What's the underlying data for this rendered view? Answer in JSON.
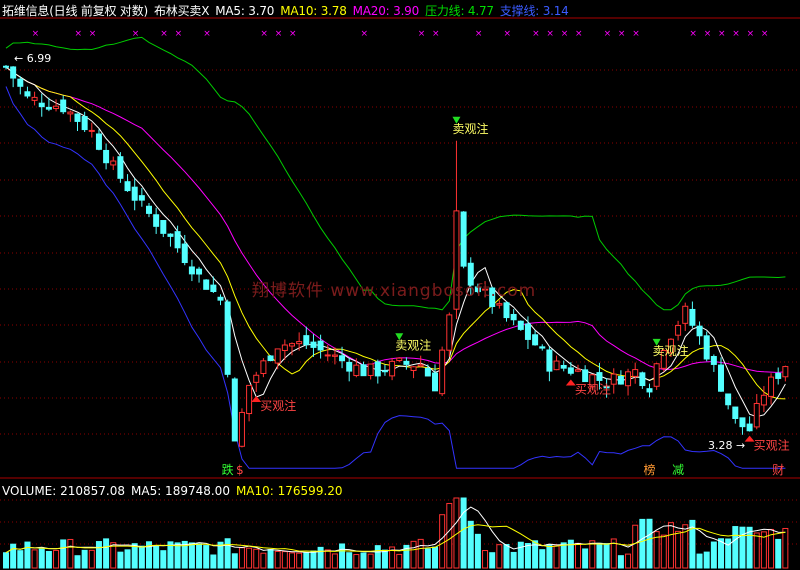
{
  "header": {
    "stock": "拓维信息(日线 前复权 对数)",
    "indicator": "布林买卖X",
    "ma5": "MA5: 3.70",
    "ma10": "MA10: 3.78",
    "ma20": "MA20: 3.90",
    "pressure": "压力线: 4.77",
    "support": "支撑线: 3.14"
  },
  "volume_header": {
    "volume": "VOLUME: 210857.08",
    "ma5": "MA5: 189748.00",
    "ma10": "MA10: 176599.20"
  },
  "watermark": "翔博软件 www.xiangbosoft.com",
  "colors": {
    "up": "#ff3232",
    "down": "#54ffff",
    "ma5": "#ffffff",
    "ma10": "#ffff00",
    "ma20": "#ff00ff",
    "upper_band": "#00cc00",
    "lower_band": "#3333ff",
    "grid": "#8b0000"
  },
  "chart_data": {
    "type": "candlestick",
    "bars": 110,
    "high_label": "6.99",
    "low_label": "3.28",
    "signals": [
      {
        "label": "卖观注",
        "index": 63,
        "kind": "sell"
      },
      {
        "label": "卖观注",
        "index": 55,
        "kind": "sell"
      },
      {
        "label": "卖观注",
        "index": 91,
        "kind": "sell"
      },
      {
        "label": "买观注",
        "index": 35,
        "kind": "buy"
      },
      {
        "label": "买观注",
        "index": 79,
        "kind": "buy"
      },
      {
        "label": "买观注",
        "index": 104,
        "kind": "buy"
      }
    ],
    "markers": [
      {
        "label": "跌",
        "index": 31
      },
      {
        "label": "$",
        "index": 33
      },
      {
        "label": "榜",
        "index": 90
      },
      {
        "label": "减",
        "index": 94
      },
      {
        "label": "财",
        "index": 108
      }
    ],
    "volume_label": "VOLUME"
  }
}
